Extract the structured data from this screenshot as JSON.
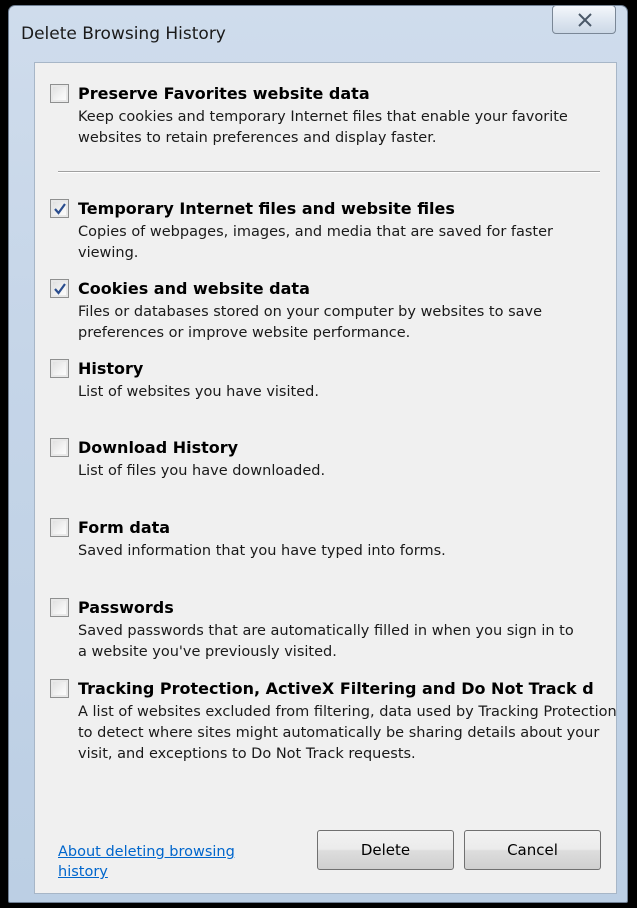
{
  "window": {
    "title": "Delete Browsing History"
  },
  "options": [
    {
      "id": "preserve-favorites",
      "title": "Preserve Favorites website data",
      "description": "Keep cookies and temporary Internet files that enable your favorite websites to retain preferences and display faster.",
      "checked": false
    },
    {
      "id": "temporary-files",
      "title": "Temporary Internet files and website files",
      "description": "Copies of webpages, images, and media that are saved for faster viewing.",
      "checked": true
    },
    {
      "id": "cookies",
      "title": "Cookies and website data",
      "description": "Files or databases stored on your computer by websites to save preferences or improve website performance.",
      "checked": true
    },
    {
      "id": "history",
      "title": "History",
      "description": "List of websites you have visited.",
      "checked": false
    },
    {
      "id": "download-history",
      "title": "Download History",
      "description": "List of files you have downloaded.",
      "checked": false
    },
    {
      "id": "form-data",
      "title": "Form data",
      "description": "Saved information that you have typed into forms.",
      "checked": false
    },
    {
      "id": "passwords",
      "title": "Passwords",
      "description": "Saved passwords that are automatically filled in when you sign in to a website you've previously visited.",
      "checked": false
    },
    {
      "id": "tracking-protection",
      "title": "Tracking Protection, ActiveX Filtering and Do Not Track d",
      "description": "A list of websites excluded from filtering, data used by Tracking Protection to detect where sites might automatically be sharing details about your visit, and exceptions to Do Not Track requests.",
      "checked": false
    }
  ],
  "footer": {
    "help_link": "About deleting browsing history",
    "delete_label": "Delete",
    "cancel_label": "Cancel"
  }
}
